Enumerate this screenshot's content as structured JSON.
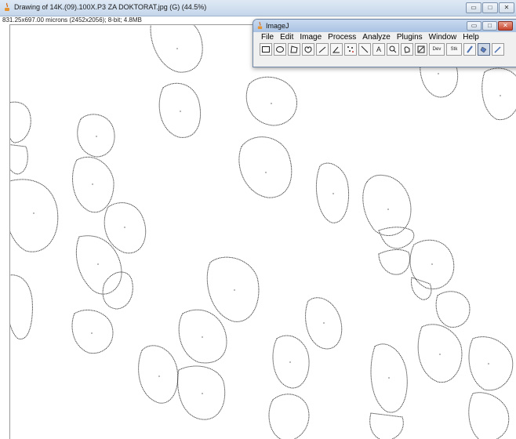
{
  "image_window": {
    "title": "Drawing of 14K.(09).100X.P3 ZA DOKTORAT.jpg (G) (44.5%)",
    "info": "831.25x697.00 microns (2452x2056); 8-bit; 4.8MB",
    "controls": [
      "minimize-icon",
      "maximize-icon",
      "close-icon"
    ]
  },
  "imagej": {
    "title": "ImageJ",
    "menu": [
      "File",
      "Edit",
      "Image",
      "Process",
      "Analyze",
      "Plugins",
      "Window",
      "Help"
    ],
    "tools": [
      {
        "name": "rectangle-tool",
        "glyph": ""
      },
      {
        "name": "oval-tool",
        "glyph": ""
      },
      {
        "name": "polygon-tool",
        "glyph": ""
      },
      {
        "name": "freehand-tool",
        "glyph": ""
      },
      {
        "name": "line-tool",
        "glyph": ""
      },
      {
        "name": "angle-tool",
        "glyph": ""
      },
      {
        "name": "point-tool",
        "glyph": ""
      },
      {
        "name": "wand-tool",
        "glyph": ""
      },
      {
        "name": "text-tool",
        "glyph": "A"
      },
      {
        "name": "magnifier-tool",
        "glyph": ""
      },
      {
        "name": "hand-tool",
        "glyph": ""
      },
      {
        "name": "dropper-tool",
        "glyph": ""
      },
      {
        "name": "developer-menu",
        "glyph": "Dev"
      },
      {
        "name": "stacks-menu",
        "glyph": "Stk"
      },
      {
        "name": "brush-tool",
        "glyph": ""
      },
      {
        "name": "flood-fill-tool",
        "glyph": ""
      },
      {
        "name": "pencil-tool",
        "glyph": ""
      }
    ]
  },
  "colors": {
    "title_bar": "#c5d6ea",
    "canvas_background": "#ffffff",
    "outline": "#444444"
  }
}
